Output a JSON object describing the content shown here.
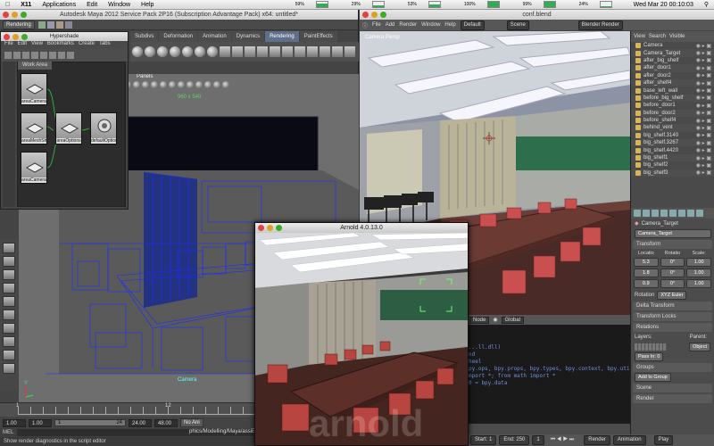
{
  "menubar": {
    "x11": "X11",
    "items": [
      "Applications",
      "Edit",
      "Window",
      "Help"
    ],
    "meters": [
      {
        "label": "59%",
        "level": 0.59
      },
      {
        "label": "29%",
        "level": 0.29
      },
      {
        "label": "53%",
        "level": 0.53
      },
      {
        "label": "100%",
        "level": 1.0
      },
      {
        "label": "99%",
        "level": 0.99
      },
      {
        "label": "24%",
        "level": 0.24
      }
    ],
    "clock": "Wed Mar 20  00:10:03"
  },
  "maya": {
    "title": "Autodesk Maya 2012 Service Pack 2P16 (Subscription Advantage Pack) x64: untitled*",
    "mode_dropdown": "Rendering",
    "shelf_tabs": [
      "Subdivs",
      "Deformation",
      "Animation",
      "Dynamics",
      "Rendering",
      "PaintEffects"
    ],
    "active_shelf": "Rendering",
    "viewport": {
      "panels_menu": "Panels",
      "resolution_gate": "960 x 540",
      "camera_label": "Camera"
    },
    "timeline": {
      "start_label": "1",
      "labels": [
        "1",
        "12",
        "24"
      ]
    },
    "range": {
      "start": "1.00",
      "playback_start": "1.00",
      "slider_left": "1",
      "slider_right": "24",
      "playback_end": "24.00",
      "end": "48.00",
      "autokey": "No Ani"
    },
    "mel_label": "MEL",
    "mel_path": "phics/Modelling/Maya/assiExp",
    "help_line": "Show render diagnostics in the script editor"
  },
  "hypershade": {
    "title": "Hypershade",
    "menu": [
      "File",
      "Edit",
      "View",
      "Bookmarks",
      "Create",
      "Tabs"
    ],
    "work_area_tab": "Work Area",
    "nodes": [
      "areaCamera1",
      "areaMeshSh...",
      "areaOptions",
      "defaultOptions...",
      "areaCamera1"
    ]
  },
  "blender": {
    "title": "conf.blend",
    "menu": [
      "File",
      "Add",
      "Render",
      "Window",
      "Help"
    ],
    "layout": "Default",
    "scene": "Scene",
    "engine": "Blender Render",
    "viewport_label": "Camera Persp",
    "header": {
      "mode": "Node",
      "orientation": "Global"
    },
    "console_lines": [
      "...ll.dll)",
      "nd",
      "",
      "heel",
      "py.ops, bpy.props, bpy.types, bpy.context, bpy.util",
      "mport *; from math import *",
      "0 = bpy.data"
    ],
    "frames": {
      "start": "Start: 1",
      "end": "End: 250",
      "current": "1",
      "render_menu": "Render",
      "animation_label": "Animation",
      "play_label": "Play"
    },
    "outliner": {
      "view_menu": "View",
      "search_menu": "Search",
      "all_scenes": "Visible",
      "items": [
        "Camera",
        "Camera_Target",
        "after_big_shelf",
        "after_door1",
        "after_door2",
        "after_shelf4",
        "base_left_wall",
        "before_big_shelf",
        "before_door1",
        "before_door2",
        "before_shelf4",
        "behind_vent",
        "big_shelf.3140",
        "big_shelf.3267",
        "big_shelf.4420",
        "big_shelf1",
        "big_shelf2",
        "big_shelf3"
      ]
    },
    "properties": {
      "object_name": "Camera_Target",
      "object_field": "Camera_Target",
      "transform_header": "Transform",
      "location_label": "Locatio",
      "rotation_label": "Rotatio",
      "scale_label": "Scale:",
      "location": [
        "5.3",
        "1.8",
        "0.9"
      ],
      "rotation": [
        "0°",
        "0°",
        "0°"
      ],
      "scale": [
        "1.00",
        "1.00",
        "1.00"
      ],
      "rotation_mode_label": "Rotation",
      "rotation_mode": "XYZ Euler",
      "delta_transform": "Delta Transform",
      "transform_locks": "Transform Locks",
      "relations": "Relations",
      "layers_label": "Layers:",
      "parent_label": "Parent:",
      "parent_type": "Object",
      "pass_index": "Pass In: 0",
      "groups": "Groups",
      "add_to_group": "Add to Group",
      "scene_label": "Scene",
      "render_label": "Render"
    }
  },
  "arnold": {
    "title": "Arnold 4.0.13.0",
    "watermark": "arnold"
  },
  "colors": {
    "mac_red": "#e0443e",
    "mac_yellow": "#dea123",
    "mac_green": "#3bac2a",
    "maya_active_shelf": "#5f6f8a",
    "wire_blue": "#1a2cff",
    "blender_console_text": "#6f8fd8"
  }
}
